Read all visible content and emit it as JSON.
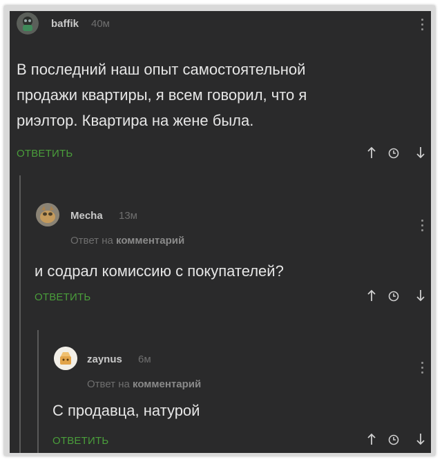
{
  "comments": [
    {
      "username": "baffik",
      "time": "40м",
      "text_lines": [
        "В последний наш опыт самостоятельной",
        "продажи квартиры, я всем говорил, что я",
        "риэлтор. Квартира на жене была."
      ],
      "reply_label": "ОТВЕТИТЬ"
    },
    {
      "username": "Mecha",
      "time": "13м",
      "reply_prefix": "Ответ на",
      "reply_target": "комментарий",
      "text_lines": [
        "и содрал комиссию с покупателей?"
      ],
      "reply_label": "ОТВЕТИТЬ"
    },
    {
      "username": "zaynus",
      "time": "6м",
      "reply_prefix": "Ответ на",
      "reply_target": "комментарий",
      "text_lines": [
        "С продавца, натурой"
      ],
      "reply_label": "ОТВЕТИТЬ"
    }
  ],
  "icons": {
    "vote_up": "arrow-up-icon",
    "save": "clock-icon",
    "vote_down": "arrow-down-icon",
    "menu": "kebab-menu-icon"
  },
  "colors": {
    "background": "#2a2a2b",
    "reply_button": "#4a9e3b",
    "text": "#e6e6e6",
    "meta": "#6f6f6f"
  }
}
